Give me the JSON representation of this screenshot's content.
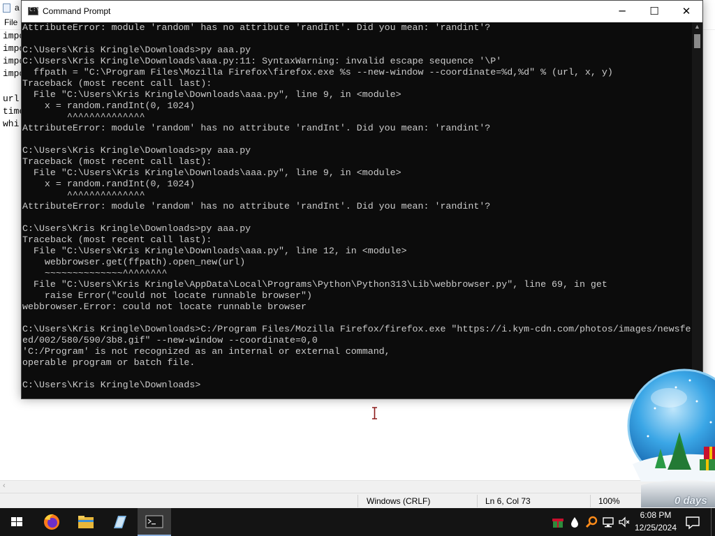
{
  "notepad": {
    "title": "aaa.py - Notepad",
    "title_visible": "a",
    "menu": [
      "File"
    ],
    "code_fragments": [
      "impo",
      "impo",
      "impo",
      "impo",
      "",
      "url",
      "time",
      "whi"
    ],
    "status": {
      "line_endings": "Windows (CRLF)",
      "position": "Ln 6, Col 73",
      "zoom": "100%"
    }
  },
  "cmd": {
    "title": "Command Prompt",
    "minimize": "─",
    "maximize": "☐",
    "close": "✕",
    "lines": [
      "AttributeError: module 'random' has no attribute 'randInt'. Did you mean: 'randint'?",
      "",
      "C:\\Users\\Kris Kringle\\Downloads>py aaa.py",
      "C:\\Users\\Kris Kringle\\Downloads\\aaa.py:11: SyntaxWarning: invalid escape sequence '\\P'",
      "  ffpath = \"C:\\Program Files\\Mozilla Firefox\\firefox.exe %s --new-window --coordinate=%d,%d\" % (url, x, y)",
      "Traceback (most recent call last):",
      "  File \"C:\\Users\\Kris Kringle\\Downloads\\aaa.py\", line 9, in <module>",
      "    x = random.randInt(0, 1024)",
      "        ^^^^^^^^^^^^^^",
      "AttributeError: module 'random' has no attribute 'randInt'. Did you mean: 'randint'?",
      "",
      "C:\\Users\\Kris Kringle\\Downloads>py aaa.py",
      "Traceback (most recent call last):",
      "  File \"C:\\Users\\Kris Kringle\\Downloads\\aaa.py\", line 9, in <module>",
      "    x = random.randInt(0, 1024)",
      "        ^^^^^^^^^^^^^^",
      "AttributeError: module 'random' has no attribute 'randInt'. Did you mean: 'randint'?",
      "",
      "C:\\Users\\Kris Kringle\\Downloads>py aaa.py",
      "Traceback (most recent call last):",
      "  File \"C:\\Users\\Kris Kringle\\Downloads\\aaa.py\", line 12, in <module>",
      "    webbrowser.get(ffpath).open_new(url)",
      "    ~~~~~~~~~~~~~~^^^^^^^^",
      "  File \"C:\\Users\\Kris Kringle\\AppData\\Local\\Programs\\Python\\Python313\\Lib\\webbrowser.py\", line 69, in get",
      "    raise Error(\"could not locate runnable browser\")",
      "webbrowser.Error: could not locate runnable browser",
      "",
      "C:\\Users\\Kris Kringle\\Downloads>C:/Program Files/Mozilla Firefox/firefox.exe \"https://i.kym-cdn.com/photos/images/newsfe",
      "ed/002/580/590/3b8.gif\" --new-window --coordinate=0,0",
      "'C:/Program' is not recognized as an internal or external command,",
      "operable program or batch file.",
      "",
      "C:\\Users\\Kris Kringle\\Downloads>"
    ]
  },
  "snowglobe": {
    "label": "0 days"
  },
  "taskbar": {
    "apps": [
      {
        "name": "firefox",
        "icon": "firefox-icon"
      },
      {
        "name": "file-explorer",
        "icon": "folder-icon"
      },
      {
        "name": "notepad",
        "icon": "notepad-icon"
      },
      {
        "name": "command-prompt",
        "icon": "cmd-icon"
      }
    ],
    "tray_icons": [
      "gift-icon",
      "water-drop-icon",
      "magnifier-icon",
      "network-icon",
      "speaker-muted-icon"
    ],
    "clock": {
      "time": "6:08 PM",
      "date": "12/25/2024"
    }
  },
  "colors": {
    "console_bg": "#0c0c0c",
    "console_text": "#cccccc",
    "taskbar_bg": "#141414",
    "accent": "#8fb3e0"
  }
}
